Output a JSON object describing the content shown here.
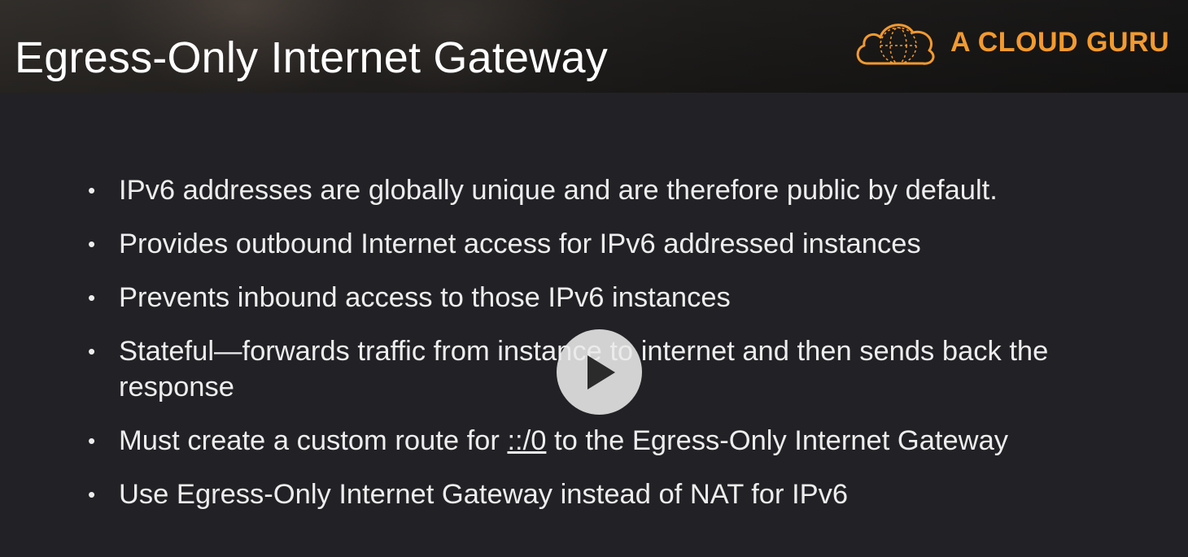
{
  "slide": {
    "title": "Egress-Only Internet Gateway",
    "brand_name": "A CLOUD GURU",
    "brand_logo_icon": "cloud-logo-icon",
    "accent_color": "#f39a2e",
    "bullets": [
      {
        "text": "IPv6 addresses are globally unique and are therefore public by default."
      },
      {
        "text": "Provides outbound Internet access for IPv6 addressed instances"
      },
      {
        "text": "Prevents inbound access to those IPv6 instances"
      },
      {
        "text": "Stateful—forwards traffic from instance to internet and then sends back the response"
      },
      {
        "before": "Must create a custom route for ",
        "link": "::/0",
        "after": " to the Egress-Only Internet Gateway"
      },
      {
        "text": "Use Egress-Only Internet Gateway instead of NAT for IPv6"
      }
    ],
    "bullet_glyph": "•"
  },
  "player": {
    "play_icon": "play-icon"
  }
}
